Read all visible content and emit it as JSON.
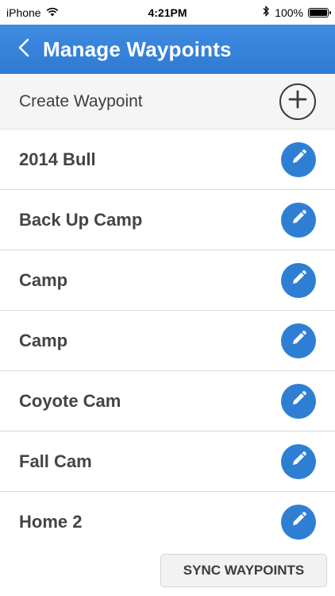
{
  "status_bar": {
    "carrier": "iPhone",
    "time": "4:21PM",
    "battery_percent_label": "100%",
    "battery_level": 1.0
  },
  "nav": {
    "title": "Manage Waypoints",
    "back_icon": "chevron-left-icon"
  },
  "create": {
    "label": "Create Waypoint",
    "icon": "plus-circle-icon"
  },
  "waypoints": [
    {
      "label": "2014 Bull"
    },
    {
      "label": "Back Up Camp"
    },
    {
      "label": "Camp"
    },
    {
      "label": "Camp"
    },
    {
      "label": "Coyote Cam"
    },
    {
      "label": "Fall Cam"
    },
    {
      "label": "Home 2"
    }
  ],
  "footer": {
    "sync_label": "SYNC WAYPOINTS"
  },
  "colors": {
    "accent": "#2e7fd4",
    "nav_bar": "#3a86dc"
  }
}
